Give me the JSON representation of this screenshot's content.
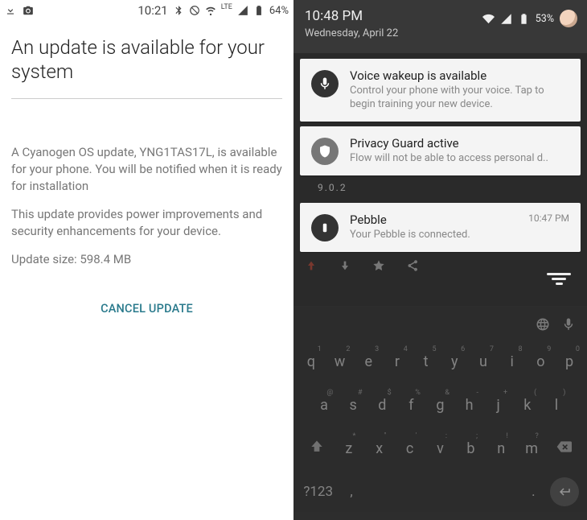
{
  "left": {
    "statusbar": {
      "time": "10:21",
      "battery_pct": "64%"
    },
    "title": "An update is available for your system",
    "para1": "A Cyanogen OS update, YNG1TAS17L, is available for your phone. You will be notified when it is ready for installation",
    "para2": "This update provides power improvements and security enhancements for your device.",
    "para3": "Update size: 598.4 MB",
    "cancel_label": "CANCEL UPDATE"
  },
  "right": {
    "shade": {
      "time": "10:48 PM",
      "date": "Wednesday, April 22",
      "battery_pct": "53%"
    },
    "notifications": [
      {
        "id": "voice",
        "title": "Voice wakeup is available",
        "body": "Control your phone with your voice. Tap to begin training your new device."
      },
      {
        "id": "privacy",
        "title": "Privacy Guard active",
        "body": "Flow will not be able to access personal d.."
      }
    ],
    "peek_version": "9.0.2",
    "pebble": {
      "title": "Pebble",
      "body": "Your Pebble is connected.",
      "time": "10:47 PM"
    },
    "keyboard": {
      "row1": [
        "q",
        "w",
        "e",
        "r",
        "t",
        "y",
        "u",
        "i",
        "o",
        "p"
      ],
      "row1sup": [
        "1",
        "2",
        "3",
        "4",
        "5",
        "6",
        "7",
        "8",
        "9",
        "0"
      ],
      "row2": [
        "a",
        "s",
        "d",
        "f",
        "g",
        "h",
        "j",
        "k",
        "l"
      ],
      "row2sup": [
        "@",
        "#",
        "$",
        "%",
        "&",
        "-",
        "+",
        "(",
        ")"
      ],
      "row3": [
        "z",
        "x",
        "c",
        "v",
        "b",
        "n",
        "m"
      ],
      "row3sup": [
        "*",
        "\"",
        "'",
        ":",
        ";",
        "!",
        "?"
      ],
      "sym": "?123",
      "comma": ",",
      "period": "."
    }
  }
}
